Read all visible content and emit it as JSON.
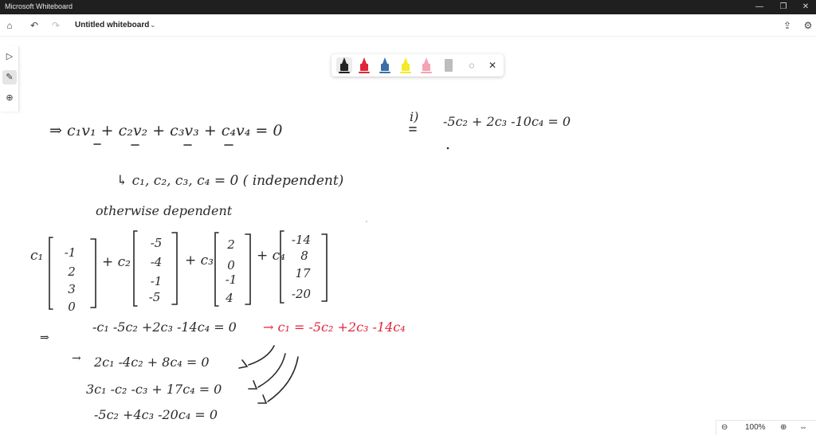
{
  "window": {
    "title": "Microsoft Whiteboard"
  },
  "toolbar": {
    "board_title": "Untitled whiteboard"
  },
  "pens": [
    {
      "name": "black-pen",
      "color": "#222222"
    },
    {
      "name": "red-pen",
      "color": "#e0243a"
    },
    {
      "name": "blue-pen",
      "color": "#3a6ea8"
    },
    {
      "name": "yellow-highlighter",
      "color": "#f2ea2a"
    },
    {
      "name": "pink-highlighter",
      "color": "#f4a3b4"
    },
    {
      "name": "ruler",
      "color": "#bdbdbd"
    }
  ],
  "zoom": {
    "level": "100%"
  },
  "ink": {
    "line1": "⇒  c₁v₁ + c₂v₂ + c₃v₃ + c₄v₄ = 0",
    "line2": "↳ c₁, c₂, c₃, c₄ = 0  ( independent)",
    "line3": "otherwise dependent",
    "c1": "c₁",
    "m1": [
      "-1",
      "2",
      "3",
      "0"
    ],
    "plus_c2": "+ c₂",
    "m2": [
      "-5",
      "-4",
      "-1",
      "-5"
    ],
    "plus_c3": "+ c₃",
    "m3": [
      "2",
      "0",
      "-1",
      "4"
    ],
    "plus_c4": "+ c₄",
    "m4": [
      "-14",
      "8",
      "17",
      "-20"
    ],
    "eq1_arrow": "⇒",
    "eq1": "-c₁  -5c₂  +2c₃  -14c₄ = 0",
    "eq1_result": "→  c₁ = -5c₂ +2c₃ -14c₄",
    "eq2_arrow": "→",
    "eq2": "2c₁  -4c₂  + 8c₄ = 0",
    "eq3": "3c₁  -c₂  -c₃  + 17c₄ = 0",
    "eq4": "-5c₂  +4c₃  -20c₄ = 0",
    "side_label": "i)",
    "side_eq": "-5c₂ + 2c₃ -10c₄ = 0",
    "ink_color": "#2a2a2a",
    "accent_color": "#e0243a"
  }
}
